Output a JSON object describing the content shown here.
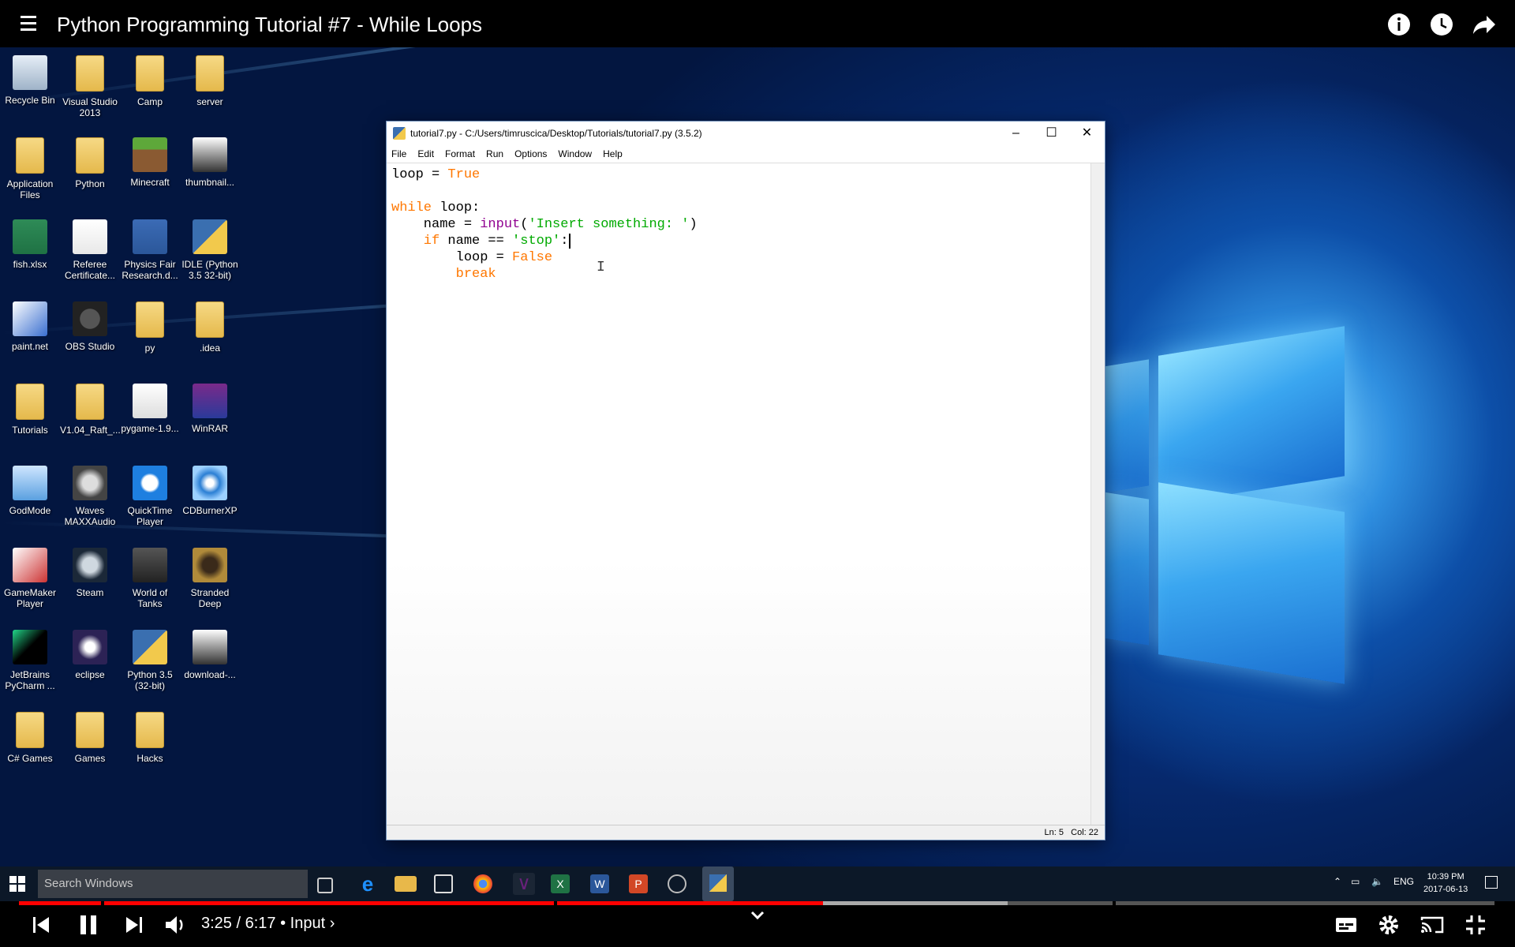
{
  "video": {
    "title": "Python Programming Tutorial #7 - While Loops",
    "time_current": "3:25",
    "time_total": "6:17",
    "chapter": "Input",
    "progress_played": 0.545,
    "progress_buffered": 0.67
  },
  "desktop_icons": [
    {
      "label": "Recycle Bin",
      "icon": "recycle-bin-icon"
    },
    {
      "label": "Visual Studio 2013",
      "icon": "folder-icon"
    },
    {
      "label": "Camp",
      "icon": "folder-icon"
    },
    {
      "label": "server",
      "icon": "folder-icon"
    },
    {
      "label": "Application Files",
      "icon": "folder-icon"
    },
    {
      "label": "Python",
      "icon": "folder-icon"
    },
    {
      "label": "Minecraft",
      "icon": "minecraft-icon"
    },
    {
      "label": "thumbnail...",
      "icon": "image-icon"
    },
    {
      "label": "fish.xlsx",
      "icon": "excel-icon"
    },
    {
      "label": "Referee Certificate...",
      "icon": "document-icon"
    },
    {
      "label": "Physics Fair Research.d...",
      "icon": "word-icon"
    },
    {
      "label": "IDLE (Python 3.5 32-bit)",
      "icon": "python-icon"
    },
    {
      "label": "paint.net",
      "icon": "paintnet-icon"
    },
    {
      "label": "OBS Studio",
      "icon": "obs-icon"
    },
    {
      "label": "py",
      "icon": "folder-icon"
    },
    {
      "label": ".idea",
      "icon": "folder-icon"
    },
    {
      "label": "Tutorials",
      "icon": "folder-icon"
    },
    {
      "label": "V1.04_Raft_...",
      "icon": "folder-icon"
    },
    {
      "label": "pygame-1.9...",
      "icon": "file-icon"
    },
    {
      "label": "WinRAR",
      "icon": "winrar-icon"
    },
    {
      "label": "GodMode",
      "icon": "control-panel-icon"
    },
    {
      "label": "Waves MAXXAudio",
      "icon": "waves-icon"
    },
    {
      "label": "QuickTime Player",
      "icon": "quicktime-icon"
    },
    {
      "label": "CDBurnerXP",
      "icon": "cd-icon"
    },
    {
      "label": "GameMaker Player",
      "icon": "gamemaker-icon"
    },
    {
      "label": "Steam",
      "icon": "steam-icon"
    },
    {
      "label": "World of Tanks",
      "icon": "wot-icon"
    },
    {
      "label": "Stranded Deep",
      "icon": "stranded-icon"
    },
    {
      "label": "JetBrains PyCharm ...",
      "icon": "pycharm-icon"
    },
    {
      "label": "eclipse",
      "icon": "eclipse-icon"
    },
    {
      "label": "Python 3.5 (32-bit)",
      "icon": "python-icon"
    },
    {
      "label": "download-...",
      "icon": "image-icon"
    },
    {
      "label": "C# Games",
      "icon": "folder-icon"
    },
    {
      "label": "Games",
      "icon": "folder-icon"
    },
    {
      "label": "Hacks",
      "icon": "folder-icon"
    }
  ],
  "idle": {
    "title": "tutorial7.py - C:/Users/timruscica/Desktop/Tutorials/tutorial7.py (3.5.2)",
    "menu": [
      "File",
      "Edit",
      "Format",
      "Run",
      "Options",
      "Window",
      "Help"
    ],
    "status": "Ln: 5   Col: 22",
    "code": {
      "l1_var": "loop",
      "l1_eq": " = ",
      "l1_val": "True",
      "l3_kw": "while",
      "l3_rest": " loop:",
      "l4_a": "    name = ",
      "l4_fn": "input",
      "l4_b": "(",
      "l4_str": "'Insert something: '",
      "l4_c": ")",
      "l5_kw": "    if",
      "l5_a": " name == ",
      "l5_str": "'stop'",
      "l5_b": ":",
      "l6_a": "        loop = ",
      "l6_val": "False",
      "l7_kw": "        break"
    }
  },
  "taskbar": {
    "search_placeholder": "Search Windows",
    "lang": "ENG",
    "time": "10:39 PM",
    "date": "2017-06-13"
  },
  "colors": {
    "keyword": "#ff7700",
    "string": "#00aa00",
    "builtin": "#900090",
    "progress": "#ff0000"
  }
}
